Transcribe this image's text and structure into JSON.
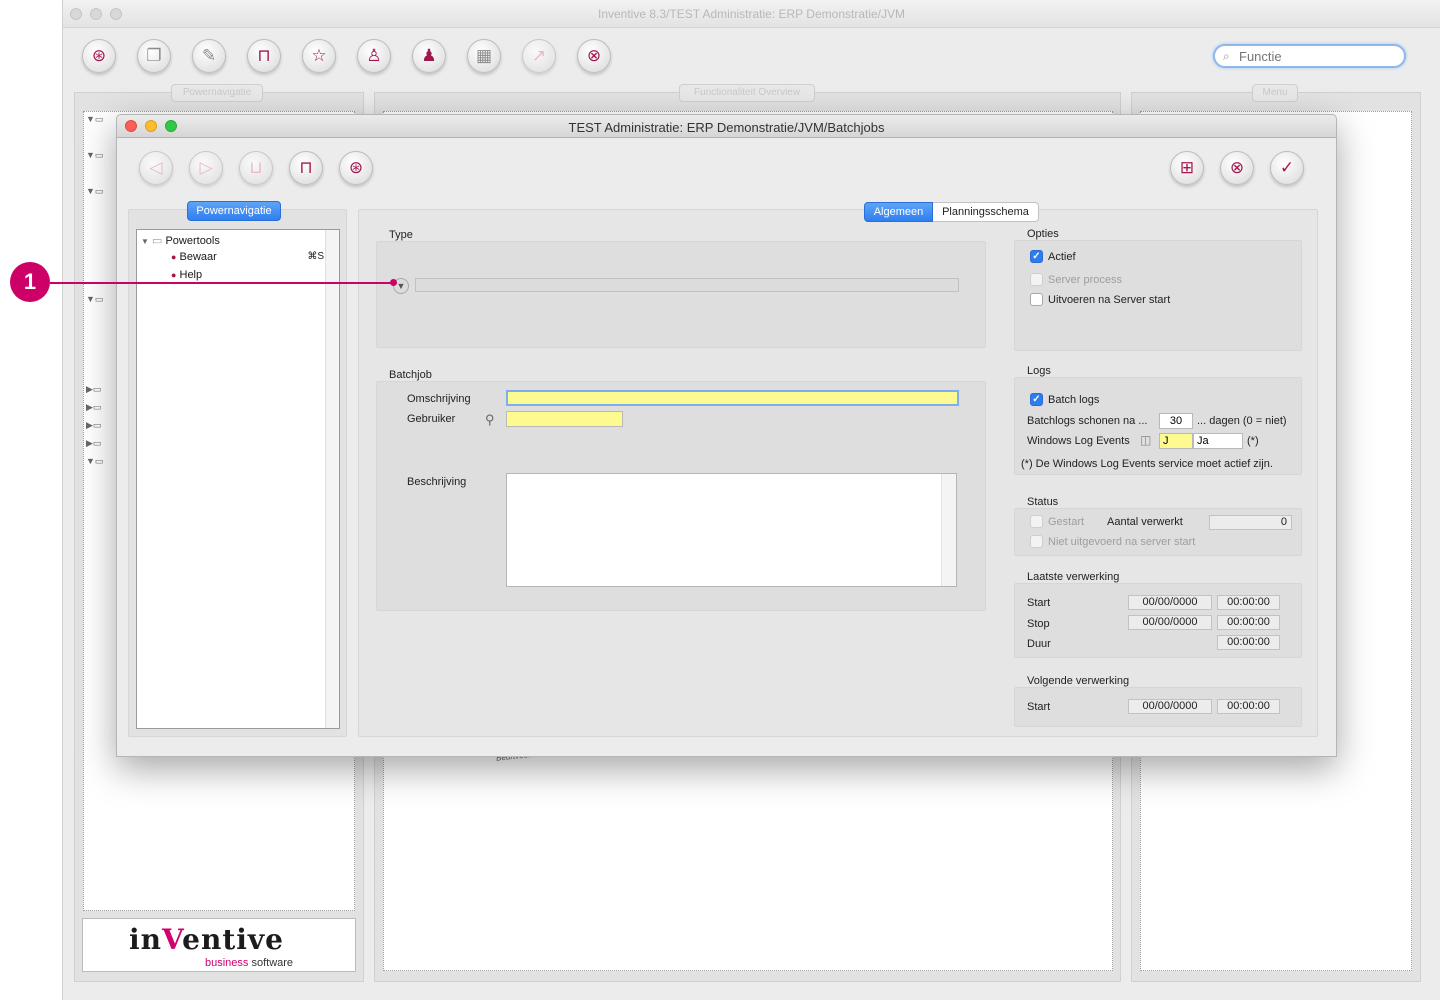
{
  "app": {
    "title": "Inventive 8.3/TEST Administratie: ERP Demonstratie/JVM"
  },
  "toolbar_icons": [
    "lifebuoy-icon",
    "pages-icon",
    "wrench-icon",
    "lock-icon",
    "star-icon",
    "user-k-icon",
    "user-icon",
    "calendar-icon",
    "chart-icon",
    "close-icon"
  ],
  "search": {
    "placeholder": "Functie"
  },
  "bg_panels": {
    "powernavigatie": "Powernavigatie",
    "overview": "Functionaliteit Overview",
    "menu": "Menu"
  },
  "logo": {
    "brand_left": "in",
    "brand_v": "V",
    "brand_right": "entive",
    "tag_color": "business",
    "tag_rest": " software"
  },
  "bg_misc": {
    "beurt": "Beurtvoortduur"
  },
  "dialog": {
    "title": "TEST Administratie: ERP Demonstratie/JVM/Batchjobs",
    "nav": {
      "pill": "Powernavigatie",
      "root": "Powertools",
      "items": [
        {
          "label": "Bewaar",
          "shortcut": "⌘S"
        },
        {
          "label": "Help",
          "shortcut": ""
        }
      ]
    },
    "tabs": [
      "Algemeen",
      "Planningsschema"
    ],
    "type_section": {
      "label": "Type"
    },
    "batchjob": {
      "label": "Batchjob",
      "omschrijving_label": "Omschrijving",
      "omschrijving_value": "",
      "gebruiker_label": "Gebruiker",
      "gebruiker_value": "",
      "beschrijving_label": "Beschrijving"
    },
    "opties": {
      "label": "Opties",
      "actief": "Actief",
      "server_process": "Server process",
      "uitvoeren": "Uitvoeren na Server start"
    },
    "logs": {
      "label": "Logs",
      "batch_logs": "Batch logs",
      "schonen_label": "Batchlogs schonen na ...",
      "schonen_value": "30",
      "schonen_suffix": "... dagen (0 = niet)",
      "windows_label": "Windows Log Events",
      "windows_code": "J",
      "windows_value": "Ja",
      "windows_star": "(*)",
      "note": "(*) De Windows Log Events service moet actief zijn."
    },
    "status": {
      "label": "Status",
      "gestart": "Gestart",
      "aantal_label": "Aantal verwerkt",
      "aantal_value": "0",
      "niet_uitgevoerd": "Niet uitgevoerd na server start"
    },
    "laatste": {
      "label": "Laatste verwerking",
      "start": "Start",
      "stop": "Stop",
      "duur": "Duur",
      "date": "00/00/0000",
      "time": "00:00:00"
    },
    "volgende": {
      "label": "Volgende verwerking",
      "start": "Start",
      "date": "00/00/0000",
      "time": "00:00:00"
    }
  },
  "callout": {
    "number": "1"
  },
  "colors": {
    "accent": "#cc0066",
    "blue": "#2f7ff0",
    "required": "#fdfa8f"
  }
}
